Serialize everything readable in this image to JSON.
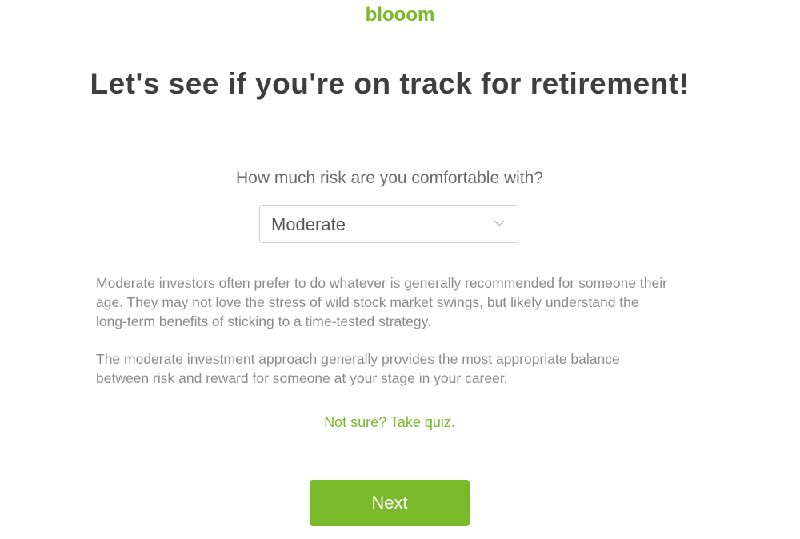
{
  "header": {
    "logo_text": "blooom"
  },
  "main": {
    "title": "Let's see if you're on track for retirement!",
    "question": "How much risk are you comfortable with?",
    "risk_select": {
      "selected": "Moderate",
      "icon": "chevron-down-icon"
    },
    "description_1": "Moderate investors often prefer to do whatever is generally recommended for someone their age. They may not love the stress of wild stock market swings, but likely understand the long-term benefits of sticking to a time-tested strategy.",
    "description_2": "The moderate investment approach generally provides the most appropriate balance between risk and reward for someone at your stage in your career.",
    "quiz_link": "Not sure? Take quiz.",
    "next_label": "Next"
  },
  "colors": {
    "brand_green": "#7ab929",
    "title_text": "#3e3e3e",
    "body_text": "#8c8c8c"
  }
}
